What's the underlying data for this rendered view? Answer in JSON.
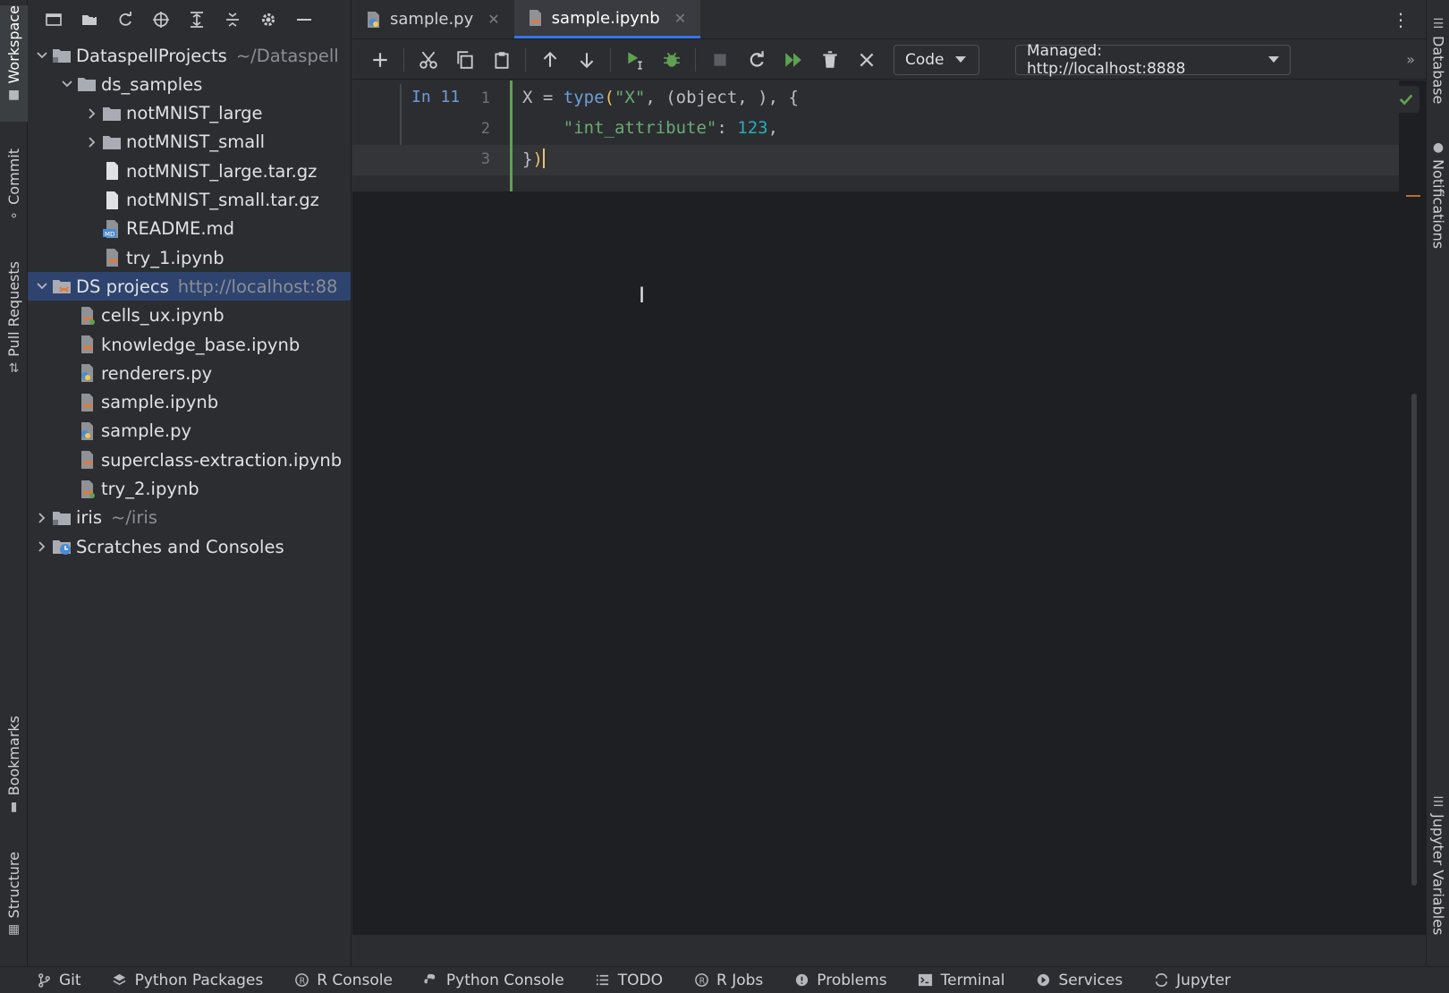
{
  "left_stripe": {
    "tabs": [
      {
        "label": "Workspace",
        "icon": "folder-icon",
        "active": true
      },
      {
        "label": "Commit",
        "icon": "commit-icon",
        "active": false
      },
      {
        "label": "Pull Requests",
        "icon": "pull-request-icon",
        "active": false
      },
      {
        "label": "Bookmarks",
        "icon": "bookmark-icon",
        "active": false
      },
      {
        "label": "Structure",
        "icon": "structure-icon",
        "active": false
      }
    ]
  },
  "right_stripe": {
    "tabs": [
      {
        "label": "Database",
        "icon": "database-icon"
      },
      {
        "label": "Notifications",
        "icon": "bell-icon"
      },
      {
        "label": "Jupyter Variables",
        "icon": "list-icon"
      }
    ]
  },
  "project_tree": {
    "rows": [
      {
        "label": "DataspellProjects",
        "path": "~/Dataspell",
        "depth": 0,
        "expanded": true,
        "kind": "root-folder"
      },
      {
        "label": "ds_samples",
        "depth": 1,
        "expanded": true,
        "kind": "folder"
      },
      {
        "label": "notMNIST_large",
        "depth": 2,
        "expanded": false,
        "kind": "folder"
      },
      {
        "label": "notMNIST_small",
        "depth": 2,
        "expanded": false,
        "kind": "folder"
      },
      {
        "label": "notMNIST_large.tar.gz",
        "depth": 2,
        "kind": "file"
      },
      {
        "label": "notMNIST_small.tar.gz",
        "depth": 2,
        "kind": "file"
      },
      {
        "label": "README.md",
        "depth": 2,
        "kind": "markdown"
      },
      {
        "label": "try_1.ipynb",
        "depth": 2,
        "kind": "notebook"
      },
      {
        "label": "DS projecs",
        "path": "http://localhost:88",
        "depth": 0,
        "expanded": true,
        "kind": "remote-root",
        "selected": true
      },
      {
        "label": "cells_ux.ipynb",
        "depth": 1,
        "kind": "notebook-synced"
      },
      {
        "label": "knowledge_base.ipynb",
        "depth": 1,
        "kind": "notebook"
      },
      {
        "label": "renderers.py",
        "depth": 1,
        "kind": "python"
      },
      {
        "label": "sample.ipynb",
        "depth": 1,
        "kind": "notebook"
      },
      {
        "label": "sample.py",
        "depth": 1,
        "kind": "python"
      },
      {
        "label": "superclass-extraction.ipynb",
        "depth": 1,
        "kind": "notebook"
      },
      {
        "label": "try_2.ipynb",
        "depth": 1,
        "kind": "notebook-synced"
      },
      {
        "label": "iris",
        "path": "~/iris",
        "depth": 0,
        "expanded": false,
        "kind": "root-folder"
      },
      {
        "label": "Scratches and Consoles",
        "depth": 0,
        "expanded": false,
        "kind": "scratches"
      }
    ]
  },
  "editor_tabs": [
    {
      "label": "sample.py",
      "icon": "python-file-icon",
      "active": false
    },
    {
      "label": "sample.ipynb",
      "icon": "notebook-file-icon",
      "active": true
    }
  ],
  "notebook_toolbar": {
    "cell_type": "Code",
    "server": "Managed: http://localhost:8888"
  },
  "cell": {
    "exec_label": "In 11",
    "line_numbers": [
      "1",
      "2",
      "3"
    ],
    "lines": [
      [
        {
          "t": "X = "
        },
        {
          "t": "type",
          "c": "kw"
        },
        {
          "t": "(",
          "c": "brace"
        },
        {
          "t": "\"X\"",
          "c": "str"
        },
        {
          "t": ", ("
        },
        {
          "t": "object",
          "c": "cls"
        },
        {
          "t": ", ), {"
        }
      ],
      [
        {
          "t": "    "
        },
        {
          "t": "\"int_attribute\"",
          "c": "str"
        },
        {
          "t": ": "
        },
        {
          "t": "123",
          "c": "num"
        },
        {
          "t": ","
        }
      ],
      [
        {
          "t": "}"
        },
        {
          "t": ")",
          "c": "brace"
        }
      ]
    ]
  },
  "bottom_tools": [
    {
      "label": "Git",
      "icon": "git-branch-icon"
    },
    {
      "label": "Python Packages",
      "icon": "layers-icon"
    },
    {
      "label": "R Console",
      "icon": "r-console-icon"
    },
    {
      "label": "Python Console",
      "icon": "python-icon"
    },
    {
      "label": "TODO",
      "icon": "list-icon"
    },
    {
      "label": "R Jobs",
      "icon": "r-jobs-icon"
    },
    {
      "label": "Problems",
      "icon": "info-icon"
    },
    {
      "label": "Terminal",
      "icon": "terminal-icon"
    },
    {
      "label": "Services",
      "icon": "play-circle-icon"
    },
    {
      "label": "Jupyter",
      "icon": "jupyter-icon"
    }
  ],
  "colors": {
    "accent": "#3574f0",
    "selection": "#2e436e",
    "run_green": "#5fa152",
    "jupyter_orange": "#e5783a"
  }
}
